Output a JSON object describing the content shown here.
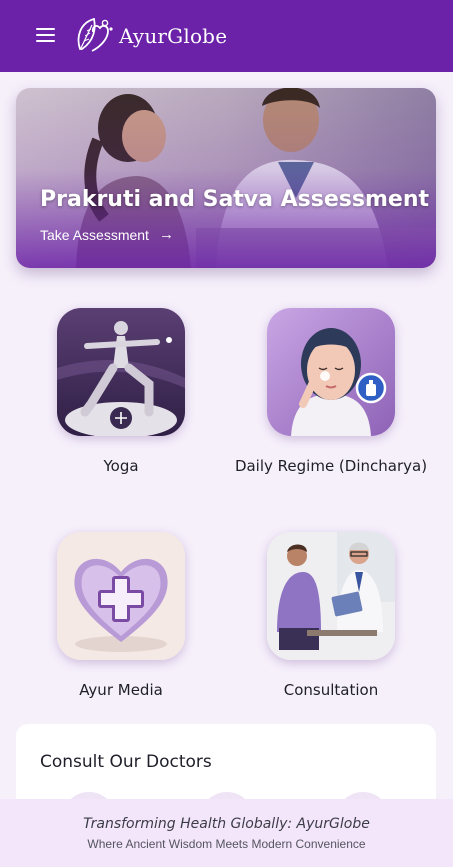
{
  "header": {
    "brand": "AyurGlobe",
    "menu_icon": "hamburger-menu-icon",
    "logo_icon": "leaf-heart-logo-icon",
    "bg_color": "#6b21a8"
  },
  "hero": {
    "title": "Prakruti and Satva Assessment",
    "link_label": "Take Assessment",
    "arrow": "→"
  },
  "tiles": [
    {
      "label": "Yoga"
    },
    {
      "label": "Daily Regime (Dincharya)"
    },
    {
      "label": "Ayur Media"
    },
    {
      "label": "Consultation"
    }
  ],
  "doctors": {
    "title": "Consult Our Doctors"
  },
  "footer": {
    "tagline": "Transforming Health Globally: AyurGlobe",
    "subline": "Where Ancient Wisdom Meets Modern Convenience"
  }
}
